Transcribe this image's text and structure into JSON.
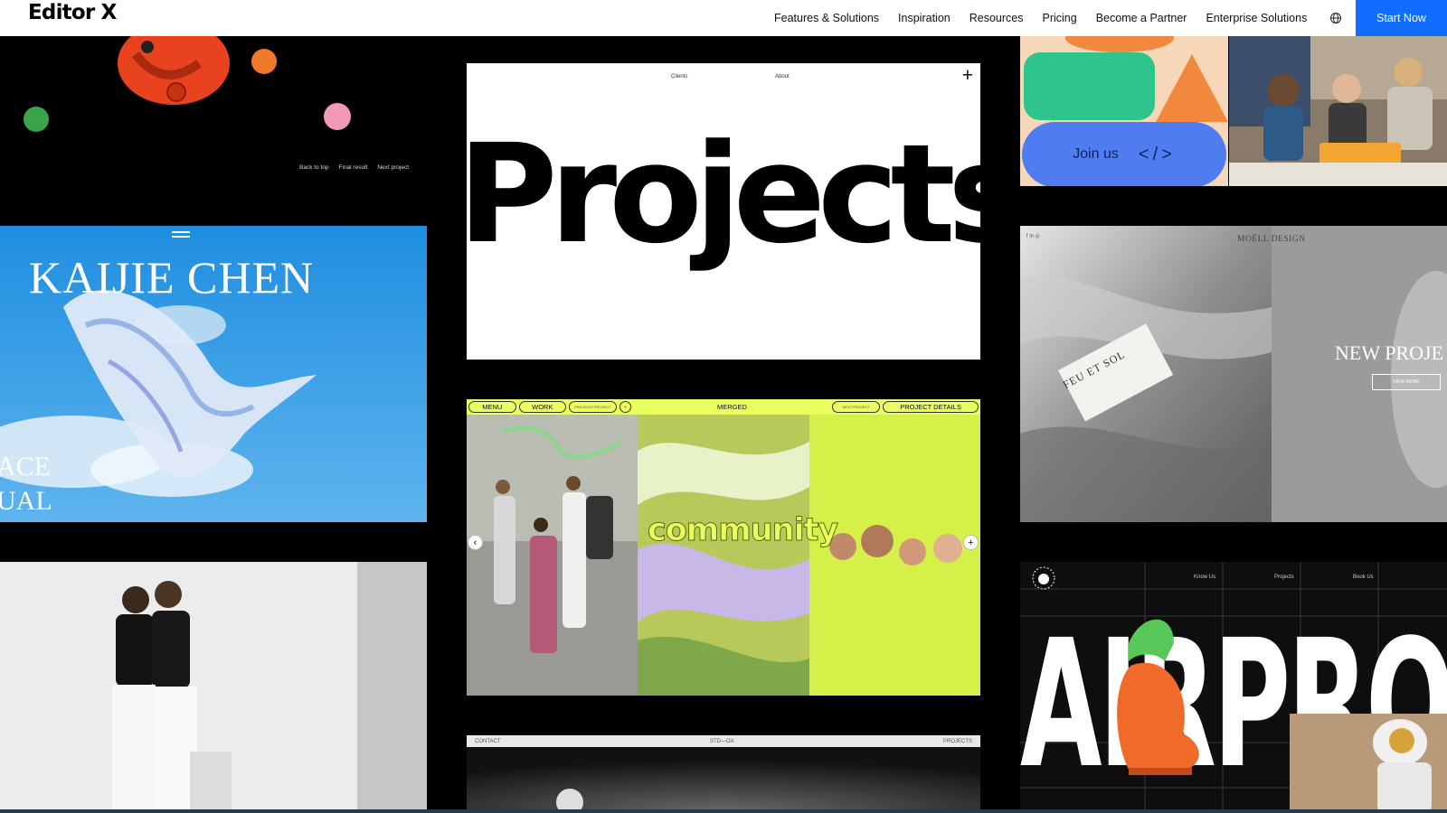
{
  "header": {
    "logo": "Editor X",
    "nav": [
      "Features & Solutions",
      "Inspiration",
      "Resources",
      "Pricing",
      "Become a Partner",
      "Enterprise Solutions"
    ],
    "cta": "Start Now"
  },
  "tiles": {
    "dark": {
      "links": [
        "Back to top",
        "Final result",
        "Next project"
      ]
    },
    "projects": {
      "nav": [
        "Clients",
        "About"
      ],
      "title": "Projects"
    },
    "shapes": {
      "join": "Join us",
      "code": "</>"
    },
    "kaijie": {
      "title": "KAIJIE CHEN",
      "side_1": "ACE",
      "side_2": "UAL"
    },
    "moell": {
      "name": "MOËLL DESIGN",
      "headline": "NEW PROJE",
      "button": "VIEW MORE",
      "card": "FEU ET SOL"
    },
    "merged": {
      "menu": "MENU",
      "work": "WORK",
      "prev": "PREVIOUS PROJECT",
      "title": "MERGED",
      "next": "NEXT PROJECT",
      "details": "PROJECT DETAILS",
      "community": "community"
    },
    "air": {
      "nav": [
        "Know Us",
        "Projects",
        "Book Us"
      ],
      "title": "AIRPRODUCT"
    },
    "stdoa": {
      "left": "CONTACT",
      "center": "STD—OA",
      "right": "PROJECTS"
    }
  }
}
